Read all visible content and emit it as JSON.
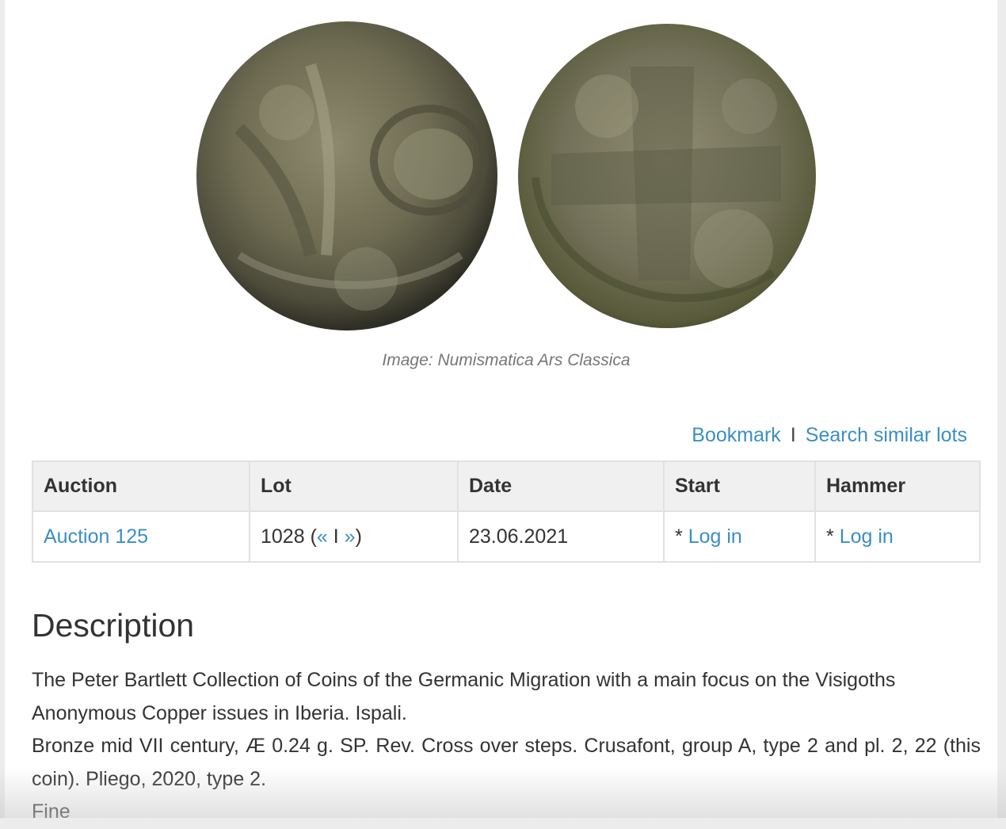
{
  "image": {
    "caption": "Image: Numismatica Ars Classica",
    "obverse_icon": "coin-obverse-image",
    "reverse_icon": "coin-reverse-image"
  },
  "actions": {
    "bookmark": "Bookmark",
    "separator": "I",
    "search_similar": "Search similar lots"
  },
  "lot_table": {
    "headers": [
      "Auction",
      "Lot",
      "Date",
      "Start",
      "Hammer"
    ],
    "row": {
      "auction": "Auction 125",
      "lot_number": "1028",
      "lot_prev": "«",
      "lot_sep": "I",
      "lot_next": "»",
      "date": "23.06.2021",
      "start_prefix": "* ",
      "start_login": "Log in",
      "hammer_prefix": "* ",
      "hammer_login": "Log in"
    }
  },
  "description": {
    "title": "Description",
    "lines": [
      "The Peter Bartlett Collection of Coins of the Germanic Migration with a main focus on the Visigoths",
      "Anonymous Copper issues in Iberia. Ispali.",
      "Bronze mid VII century, Æ 0.24 g. SP. Rev. Cross over steps. Crusafont, group A, type 2 and pl. 2, 22 (this coin). Pliego, 2020, type 2.",
      "Fine"
    ]
  },
  "colors": {
    "link": "#3a8fc4",
    "header_bg": "#f0f0f0",
    "text": "#333333",
    "caption": "#777777"
  }
}
